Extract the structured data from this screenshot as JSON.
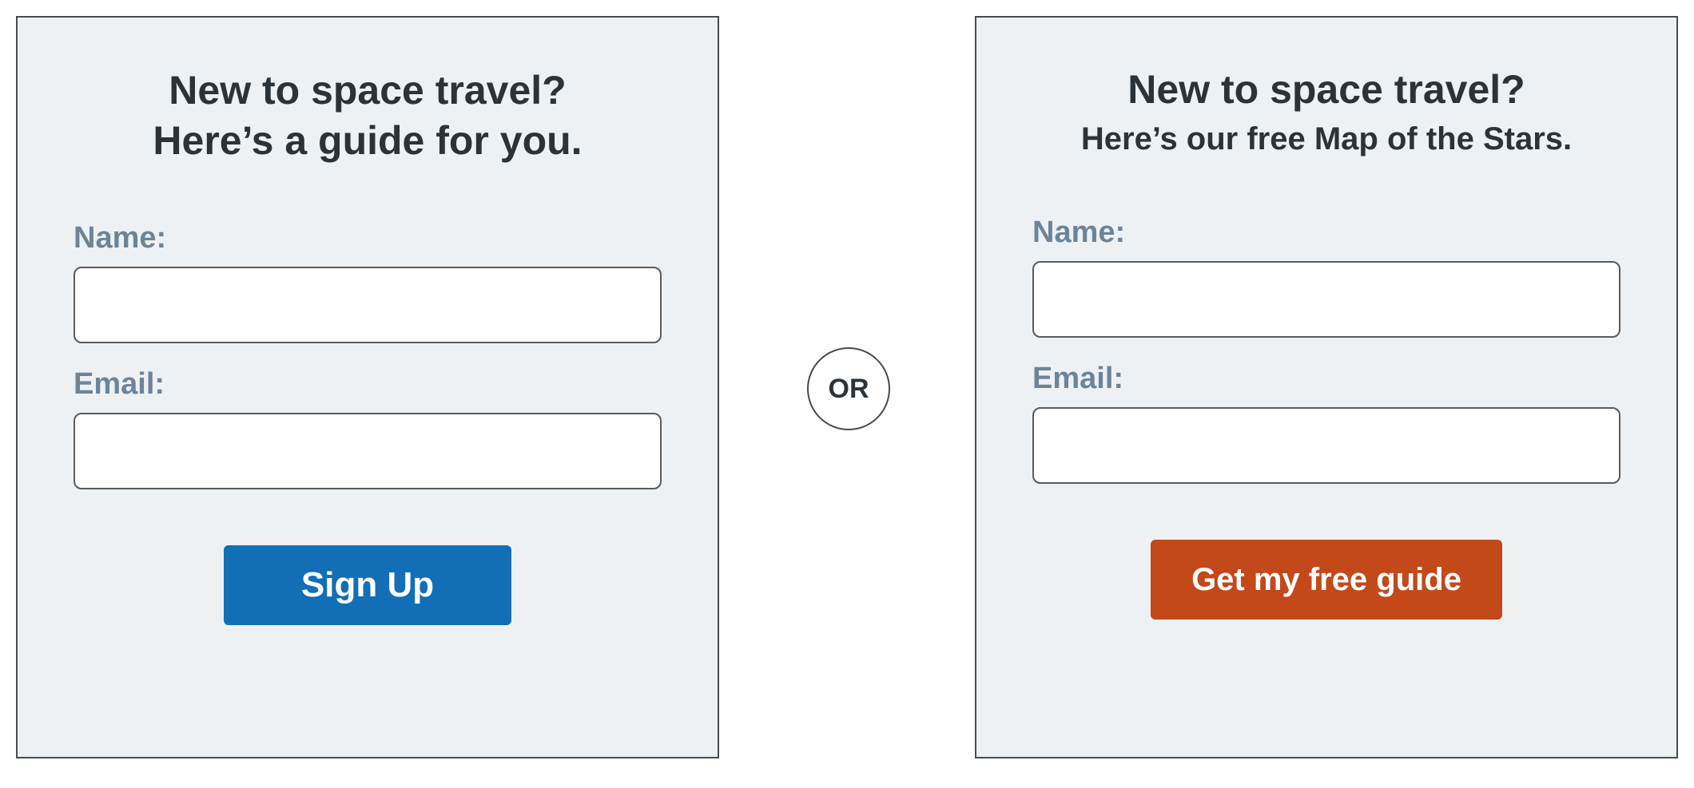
{
  "separator": {
    "label": "OR"
  },
  "left": {
    "heading_line1": "New to space travel?",
    "heading_line2": "Here’s a guide for you.",
    "name_label": "Name:",
    "email_label": "Email:",
    "name_value": "",
    "email_value": "",
    "button_label": "Sign Up",
    "button_color": "#126fb6"
  },
  "right": {
    "heading_line1": "New to space travel?",
    "heading_line2": "Here’s our free Map of the Stars.",
    "name_label": "Name:",
    "email_label": "Email:",
    "name_value": "",
    "email_value": "",
    "button_label": "Get my free guide",
    "button_color": "#c3481a"
  }
}
